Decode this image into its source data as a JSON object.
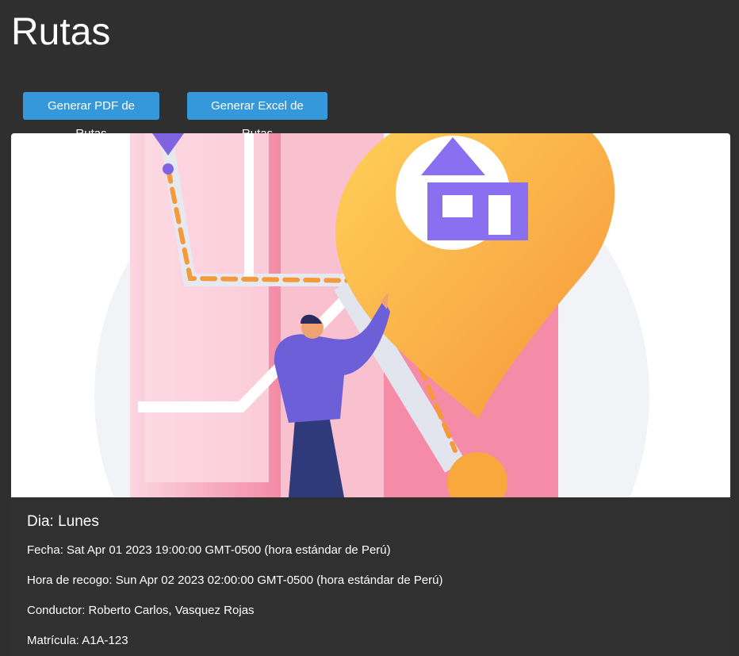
{
  "header": {
    "title": "Rutas"
  },
  "toolbar": {
    "pdf_label": "Generar PDF de Rutas",
    "excel_label": "Generar Excel de Rutas"
  },
  "card": {
    "image_icon": "map-location-illustration",
    "day": "Dia: Lunes",
    "date": "Fecha: Sat Apr 01 2023 19:00:00 GMT-0500 (hora estándar de Perú)",
    "pickup_time": "Hora de recogo: Sun Apr 02 2023 02:00:00 GMT-0500 (hora estándar de Perú)",
    "driver": "Conductor: Roberto Carlos, Vasquez Rojas",
    "plate": "Matrícula: A1A-123"
  },
  "colors": {
    "background": "#2f2f2f",
    "button": "#3498db",
    "pin": "#f8b046",
    "map": "#f7a0b5",
    "person": "#6d5fd8"
  }
}
